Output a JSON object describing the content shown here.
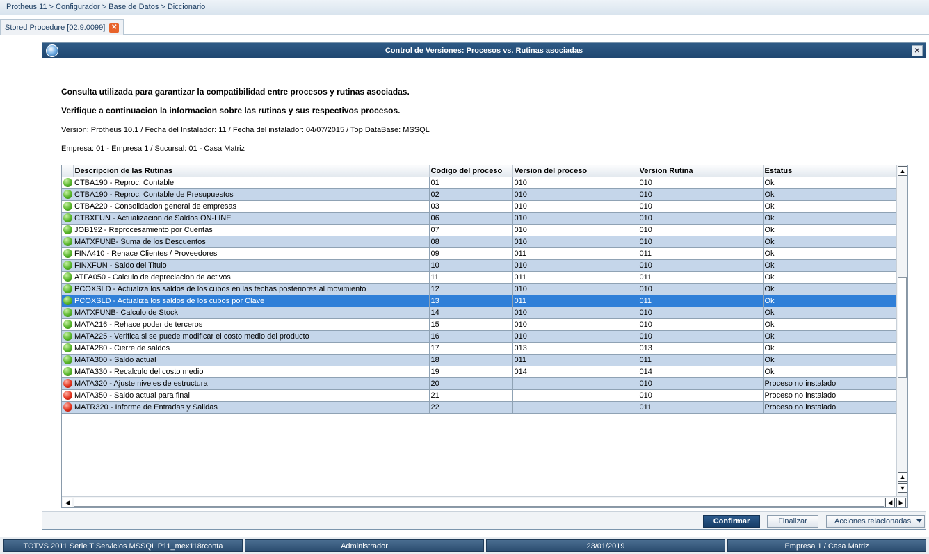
{
  "breadcrumb": "Protheus 11 > Configurador > Base de Datos > Diccionario",
  "tab": {
    "label": "Stored Procedure [02.9.0099]"
  },
  "dialog": {
    "title": "Control de Versiones: Procesos vs. Rutinas asociadas",
    "heading1": "Consulta utilizada para garantizar la compatibilidad entre procesos y rutinas asociadas.",
    "heading2": "Verifique a continuacion la informacion sobre las rutinas y sus respectivos procesos.",
    "info_version": "Version: Protheus 10.1 / Fecha del Instalador: 11 / Fecha del instalador: 04/07/2015 / Top DataBase: MSSQL",
    "info_empresa": "Empresa: 01 - Empresa 1 / Sucursal: 01 - Casa Matriz"
  },
  "grid": {
    "columns": [
      "Descripcion de las Rutinas",
      "Codigo del proceso",
      "Version del proceso",
      "Version Rutina",
      "Estatus"
    ],
    "selected_index": 10,
    "rows": [
      {
        "status": "green",
        "desc": "CTBA190 - Reproc. Contable",
        "codigo": "01",
        "vproc": "010",
        "vrut": "010",
        "estatus": "Ok"
      },
      {
        "status": "green",
        "desc": "CTBA190 - Reproc. Contable de Presupuestos",
        "codigo": "02",
        "vproc": "010",
        "vrut": "010",
        "estatus": "Ok"
      },
      {
        "status": "green",
        "desc": "CTBA220 - Consolidacion general de empresas",
        "codigo": "03",
        "vproc": "010",
        "vrut": "010",
        "estatus": "Ok"
      },
      {
        "status": "green",
        "desc": "CTBXFUN - Actualizacion de Saldos ON-LINE",
        "codigo": "06",
        "vproc": "010",
        "vrut": "010",
        "estatus": "Ok"
      },
      {
        "status": "green",
        "desc": "JOB192 - Reprocesamiento por Cuentas",
        "codigo": "07",
        "vproc": "010",
        "vrut": "010",
        "estatus": "Ok"
      },
      {
        "status": "green",
        "desc": "MATXFUNB- Suma de los Descuentos",
        "codigo": "08",
        "vproc": "010",
        "vrut": "010",
        "estatus": "Ok"
      },
      {
        "status": "green",
        "desc": "FINA410 - Rehace Clientes / Proveedores",
        "codigo": "09",
        "vproc": "011",
        "vrut": "011",
        "estatus": "Ok"
      },
      {
        "status": "green",
        "desc": "FINXFUN - Saldo del Titulo",
        "codigo": "10",
        "vproc": "010",
        "vrut": "010",
        "estatus": "Ok"
      },
      {
        "status": "green",
        "desc": "ATFA050 - Calculo de depreciacion de activos",
        "codigo": "11",
        "vproc": "011",
        "vrut": "011",
        "estatus": "Ok"
      },
      {
        "status": "green",
        "desc": "PCOXSLD - Actualiza los saldos de los cubos en las fechas posteriores al movimiento",
        "codigo": "12",
        "vproc": "010",
        "vrut": "010",
        "estatus": "Ok"
      },
      {
        "status": "green",
        "desc": "PCOXSLD - Actualiza los saldos de los cubos por Clave",
        "codigo": "13",
        "vproc": "011",
        "vrut": "011",
        "estatus": "Ok"
      },
      {
        "status": "green",
        "desc": "MATXFUNB- Calculo de Stock",
        "codigo": "14",
        "vproc": "010",
        "vrut": "010",
        "estatus": "Ok"
      },
      {
        "status": "green",
        "desc": "MATA216 - Rehace poder de terceros",
        "codigo": "15",
        "vproc": "010",
        "vrut": "010",
        "estatus": "Ok"
      },
      {
        "status": "green",
        "desc": "MATA225 - Verifica si se puede modificar el costo medio del producto",
        "codigo": "16",
        "vproc": "010",
        "vrut": "010",
        "estatus": "Ok"
      },
      {
        "status": "green",
        "desc": "MATA280 - Cierre de saldos",
        "codigo": "17",
        "vproc": "013",
        "vrut": "013",
        "estatus": "Ok"
      },
      {
        "status": "green",
        "desc": "MATA300 - Saldo actual",
        "codigo": "18",
        "vproc": "011",
        "vrut": "011",
        "estatus": "Ok"
      },
      {
        "status": "green",
        "desc": "MATA330 - Recalculo del costo medio",
        "codigo": "19",
        "vproc": "014",
        "vrut": "014",
        "estatus": "Ok"
      },
      {
        "status": "red",
        "desc": "MATA320 - Ajuste niveles de estructura",
        "codigo": "20",
        "vproc": "",
        "vrut": "010",
        "estatus": "Proceso no instalado"
      },
      {
        "status": "red",
        "desc": "MATA350 - Saldo actual para final",
        "codigo": "21",
        "vproc": "",
        "vrut": "010",
        "estatus": "Proceso no instalado"
      },
      {
        "status": "red",
        "desc": "MATR320 - Informe de Entradas y Salidas",
        "codigo": "22",
        "vproc": "",
        "vrut": "011",
        "estatus": "Proceso no instalado"
      }
    ]
  },
  "buttons": {
    "confirmar": "Confirmar",
    "finalizar": "Finalizar",
    "acciones": "Acciones relacionadas"
  },
  "statusbar": {
    "env": "TOTVS 2011 Serie T Servicios MSSQL P11_mex118rconta",
    "user": "Administrador",
    "date": "23/01/2019",
    "company": "Empresa 1 / Casa Matriz"
  },
  "colors": {
    "status_ok": "#58b52b",
    "status_error": "#e3341e",
    "row_alt": "#c5d6ea",
    "row_selected": "#2f7fd8",
    "title_bar": "#1f4670"
  }
}
